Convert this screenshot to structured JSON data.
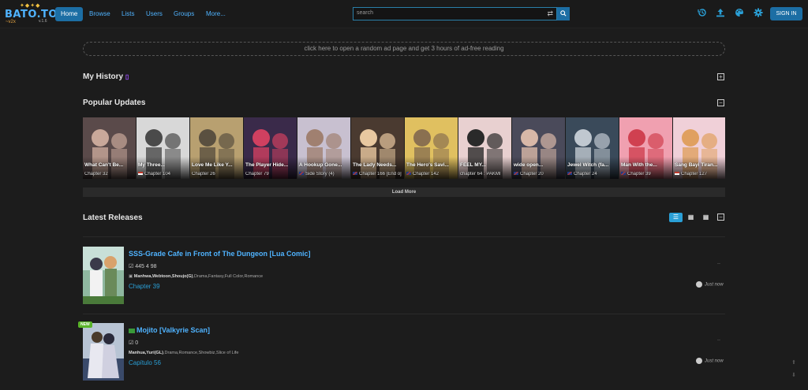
{
  "brand": {
    "name": "BATO.TO",
    "sub": "~v2x",
    "version": "v.1.6"
  },
  "nav": {
    "home": "Home",
    "browse": "Browse",
    "lists": "Lists",
    "users": "Users",
    "groups": "Groups",
    "more": "More..."
  },
  "search": {
    "placeholder": "search"
  },
  "header_icons": [
    "history-icon",
    "upload-icon",
    "palette-icon",
    "gear-icon"
  ],
  "signin_label": "SIGN IN",
  "ad_text": "click here to open a random ad page and get 3 hours of ad-free reading",
  "history": {
    "title": "My History",
    "toggle": "+"
  },
  "popular": {
    "title": "Popular Updates",
    "toggle": "−",
    "load_more": "Load More",
    "items": [
      {
        "title": "What Can't Be...",
        "chapter": "Chapter 32",
        "flag": ""
      },
      {
        "title": "My Three...",
        "chapter": "Chapter 104",
        "flag": "id"
      },
      {
        "title": "Love Me Like Y...",
        "chapter": "Chapter 26",
        "flag": ""
      },
      {
        "title": "The Player Hide...",
        "chapter": "Chapter 79",
        "flag": ""
      },
      {
        "title": "A Hookup Gone...",
        "chapter": "Side Story (4)",
        "flag": "uk"
      },
      {
        "title": "The Lady Needs...",
        "chapter": "Chapter 166 [End o]",
        "flag": "uk"
      },
      {
        "title": "The Hero's Savi...",
        "chapter": "Chapter 142",
        "flag": "uk"
      },
      {
        "title": "FEEL MY...",
        "chapter": "chapter 64 : PAKMI",
        "flag": ""
      },
      {
        "title": "wide open...",
        "chapter": "Chapter 20",
        "flag": "uk"
      },
      {
        "title": "Jewel Witch (fa...",
        "chapter": "Chapter 24",
        "flag": "uk"
      },
      {
        "title": "Man With the...",
        "chapter": "Chapter 39",
        "flag": "uk"
      },
      {
        "title": "Sang Bayi Tiran...",
        "chapter": "Chapter 127",
        "flag": "id"
      }
    ]
  },
  "latest": {
    "title": "Latest Releases",
    "toggle": "−",
    "releases": [
      {
        "title": "SSS-Grade Cafe in Front of The Dungeon [Lua Comic]",
        "stats": "445  4  98",
        "genres_bold": "Manhwa,Webtoon,Shoujo(G)",
        "genres_rest": ",Drama,Fantasy,Full Color,Romance",
        "chapter": "Chapter 39",
        "time": "Just now",
        "dots": "..",
        "badge": ""
      },
      {
        "title": "Mojito [Valkyrie Scan]",
        "stats": "0",
        "genres_bold": "Manhua,Yuri(GL)",
        "genres_rest": ",Drama,Romance,Showbiz,Slice of Life",
        "chapter": "Capítulo 56",
        "time": "Just now",
        "dots": "..",
        "badge": "NEW"
      }
    ]
  }
}
